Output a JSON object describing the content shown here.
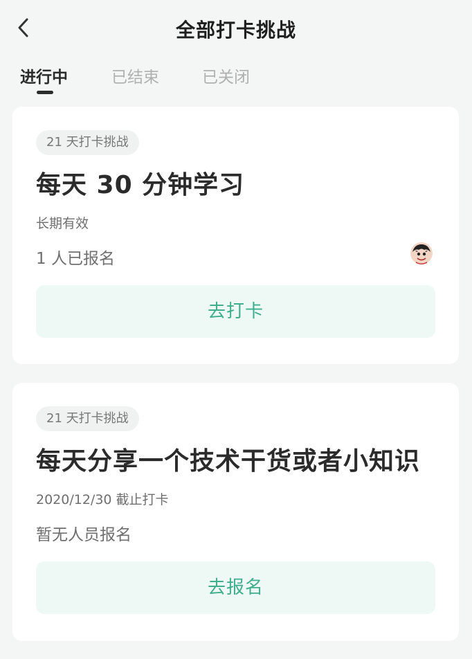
{
  "header": {
    "title": "全部打卡挑战"
  },
  "tabs": [
    {
      "label": "进行中",
      "active": true
    },
    {
      "label": "已结束",
      "active": false
    },
    {
      "label": "已关闭",
      "active": false
    }
  ],
  "challenges": [
    {
      "badge": "21 天打卡挑战",
      "title": "每天 30 分钟学习",
      "validity": "长期有效",
      "signup": "1 人已报名",
      "action": "去打卡"
    },
    {
      "badge": "21 天打卡挑战",
      "title": "每天分享一个技术干货或者小知识",
      "validity": "2020/12/30 截止打卡",
      "signup": "暂无人员报名",
      "action": "去报名"
    }
  ],
  "colors": {
    "accent": "#3fae8c",
    "button_bg": "#eef8f5",
    "page_bg": "#f4f5f5"
  },
  "icons": {
    "back": "chevron-left-icon",
    "avatar": "user-avatar"
  }
}
